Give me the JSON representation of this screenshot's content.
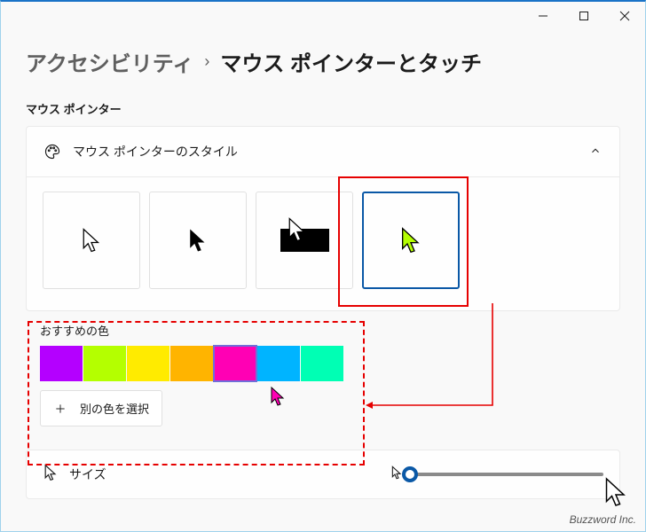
{
  "titlebar": {
    "minimize": "minimize",
    "maximize": "maximize",
    "close": "close"
  },
  "breadcrumb": {
    "parent": "アクセシビリティ",
    "separator": "›",
    "current": "マウス ポインターとタッチ"
  },
  "section": {
    "pointer_label": "マウス ポインター"
  },
  "style_card": {
    "title": "マウス ポインターのスタイル",
    "options": [
      {
        "id": "white",
        "selected": false
      },
      {
        "id": "black",
        "selected": false
      },
      {
        "id": "inverted",
        "selected": false
      },
      {
        "id": "custom",
        "selected": true
      }
    ]
  },
  "recommended": {
    "label": "おすすめの色",
    "colors": [
      {
        "name": "purple",
        "hex": "#B400FF",
        "selected": false
      },
      {
        "name": "lime",
        "hex": "#B4FF00",
        "selected": false
      },
      {
        "name": "yellow",
        "hex": "#FFEB00",
        "selected": false
      },
      {
        "name": "orange",
        "hex": "#FFB400",
        "selected": false
      },
      {
        "name": "magenta",
        "hex": "#FF00B4",
        "selected": true
      },
      {
        "name": "cyan",
        "hex": "#00B4FF",
        "selected": false
      },
      {
        "name": "teal",
        "hex": "#00FFB4",
        "selected": false
      }
    ],
    "more_label": "別の色を選択"
  },
  "size_card": {
    "title": "サイズ",
    "value": 1,
    "min": 1,
    "max": 15
  },
  "watermark": "Buzzword Inc."
}
